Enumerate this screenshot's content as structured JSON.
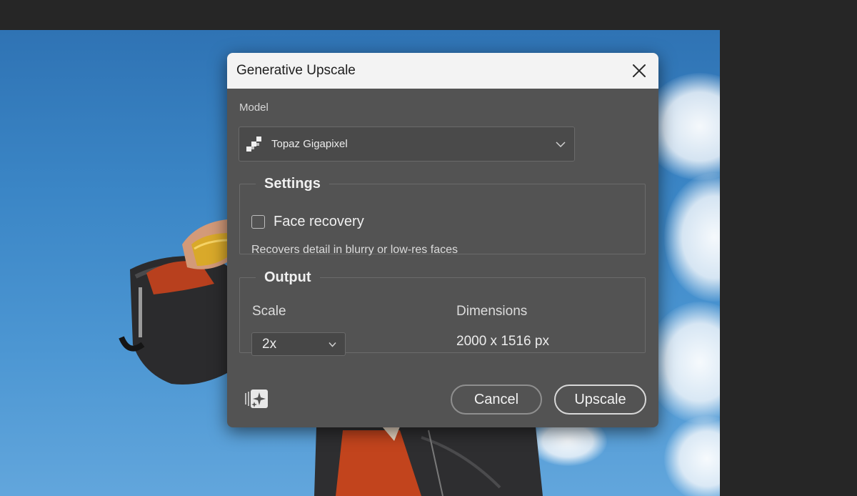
{
  "dialog": {
    "title": "Generative Upscale",
    "close_icon": "close-icon",
    "model": {
      "label": "Model",
      "selected": "Topaz Gigapixel",
      "icon": "topaz-logo-icon"
    },
    "settings": {
      "title": "Settings",
      "face_recovery_label": "Face recovery",
      "face_recovery_checked": false,
      "face_recovery_desc": "Recovers detail in blurry or low-res faces"
    },
    "output": {
      "title": "Output",
      "scale_label": "Scale",
      "scale_value": "2x",
      "dimensions_label": "Dimensions",
      "dimensions_value": "2000 x 1516 px"
    },
    "footer": {
      "feedback_icon": "generative-sparkle-icon",
      "cancel_label": "Cancel",
      "upscale_label": "Upscale"
    }
  },
  "colors": {
    "workspace_bg": "#262626",
    "dialog_bg": "#535353",
    "titlebar_bg": "#f3f3f3",
    "sky_blue": "#3b86c6"
  }
}
